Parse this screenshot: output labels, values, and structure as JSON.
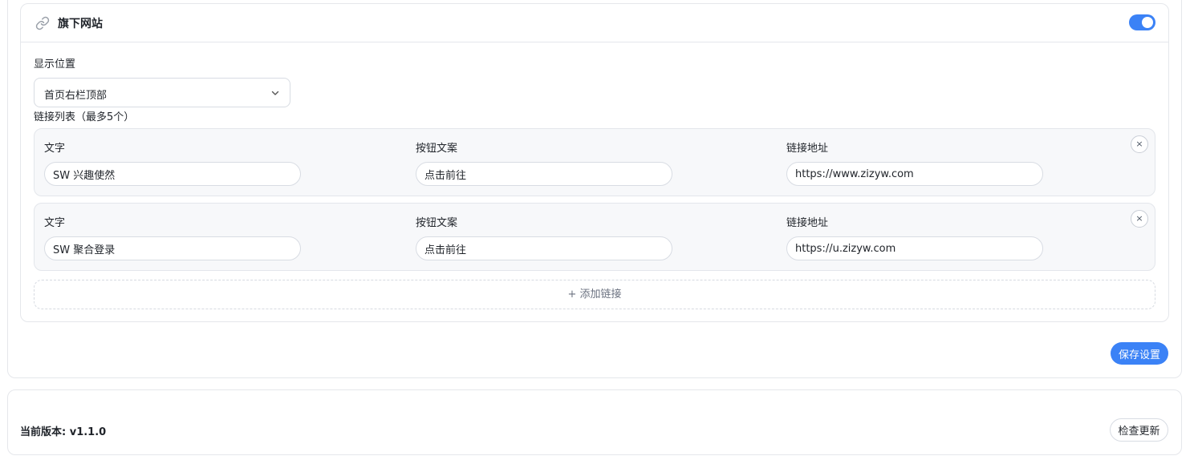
{
  "panel": {
    "title": "旗下网站",
    "icon": "link-icon",
    "enabled": true,
    "accent_color": "#3b82f6"
  },
  "display_position": {
    "label": "显示位置",
    "value": "首页右栏顶部"
  },
  "link_list": {
    "label": "链接列表（最多5个）",
    "field_labels": {
      "text": "文字",
      "button": "按钮文案",
      "url": "链接地址"
    },
    "items": [
      {
        "text": "SW 兴趣使然",
        "button": "点击前往",
        "url": "https://www.zizyw.com"
      },
      {
        "text": "SW 聚合登录",
        "button": "点击前往",
        "url": "https://u.zizyw.com"
      }
    ],
    "remove_label": "×",
    "add_label": "+ 添加链接"
  },
  "save_label": "保存设置",
  "version": {
    "text": "当前版本: v1.1.0",
    "check_label": "检查更新"
  }
}
